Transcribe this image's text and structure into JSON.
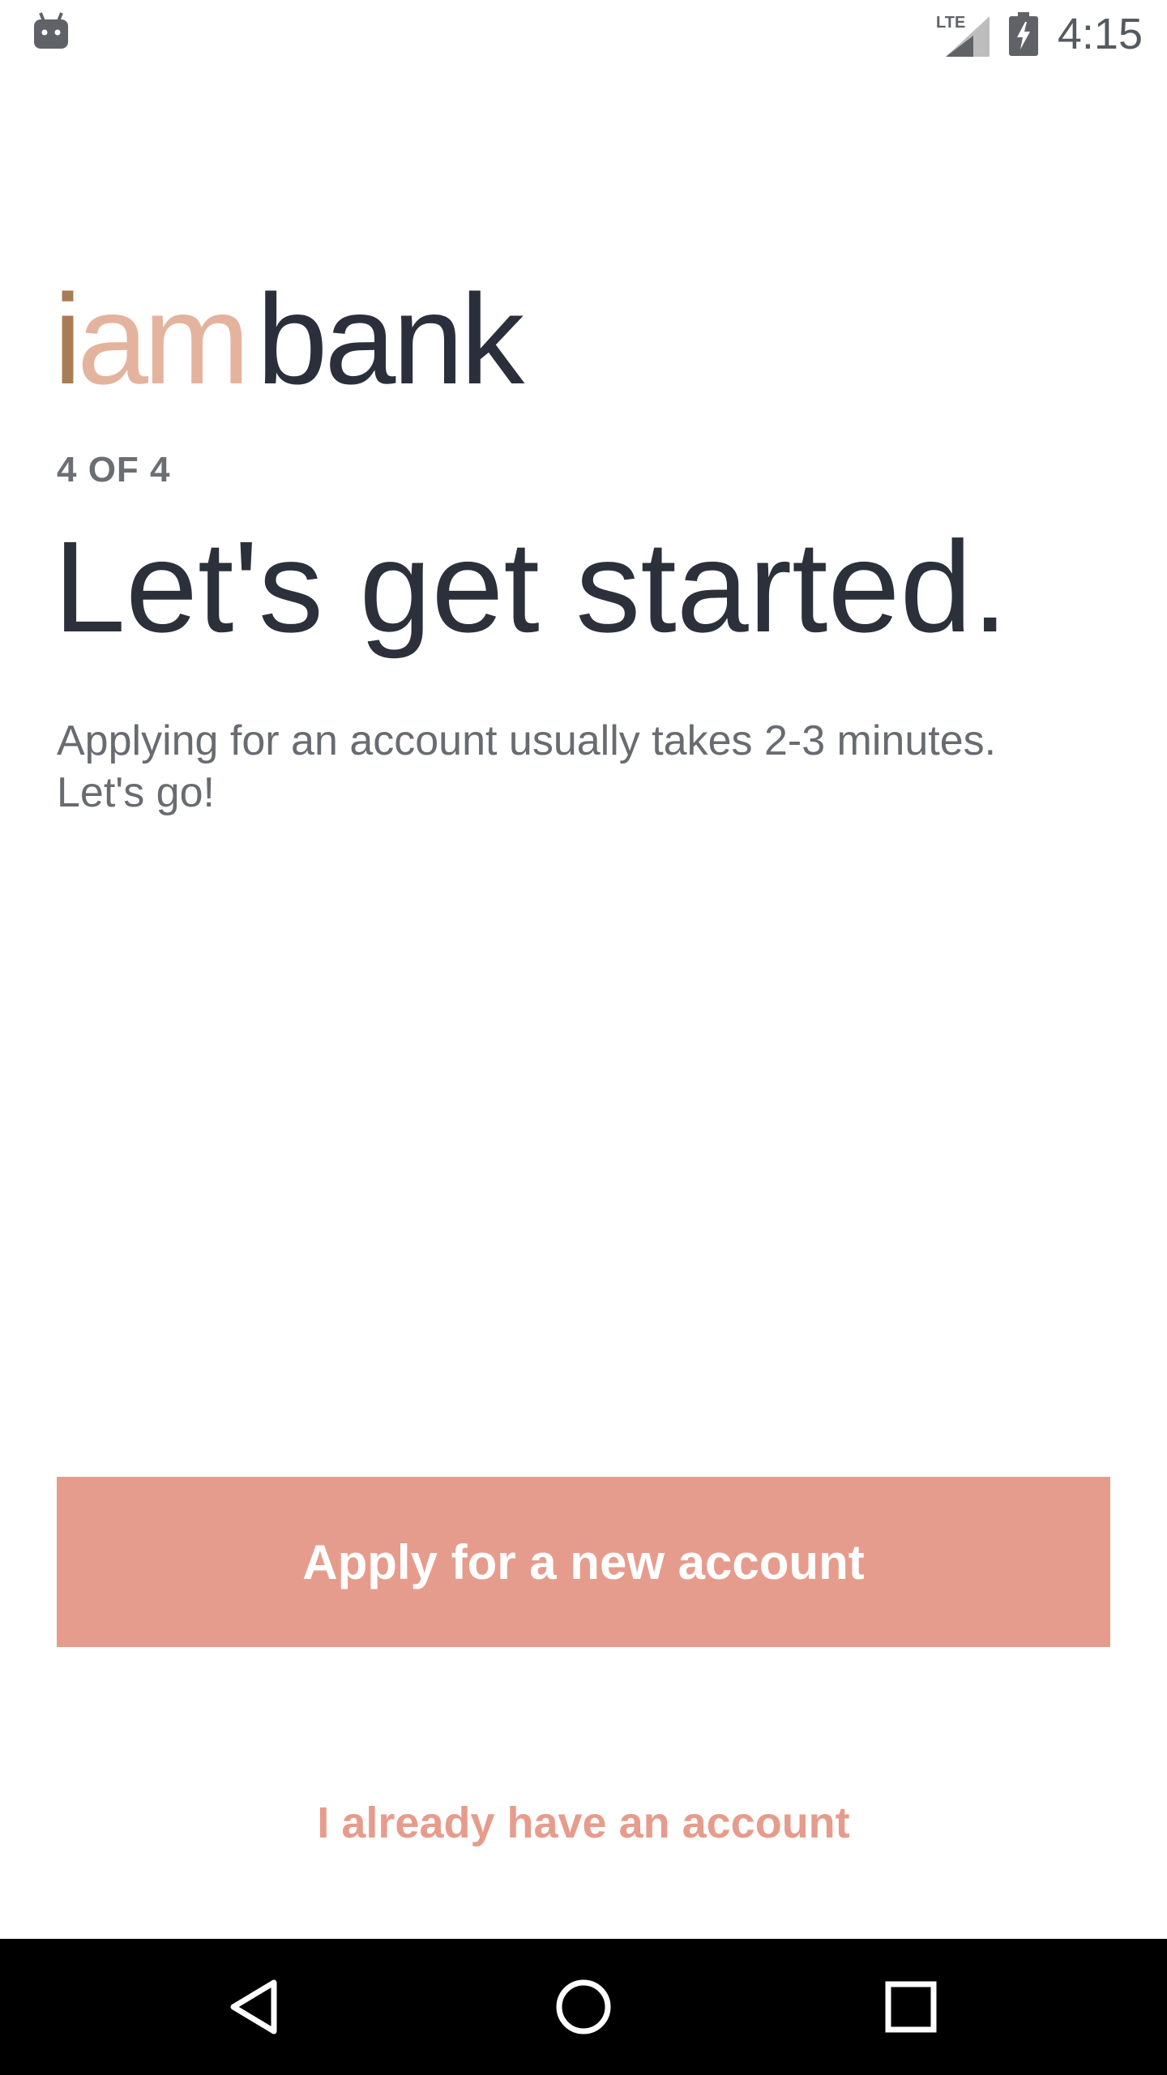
{
  "status_bar": {
    "time": "4:15",
    "network": "LTE",
    "left_icon": "android-robot-icon",
    "signal_icon": "signal-icon",
    "battery_icon": "battery-charging-icon"
  },
  "logo": {
    "part_i": "i",
    "part_am": "am",
    "part_bank": "bank",
    "colors": {
      "i": "#a87c55",
      "am": "#e4b39e",
      "bank": "#2a2f3b"
    }
  },
  "onboarding": {
    "step": "4 OF 4",
    "headline": "Let's get started.",
    "subtext_line1": "Applying for an account usually takes 2-3 minutes.",
    "subtext_line2": "Let's go!"
  },
  "actions": {
    "primary_label": "Apply for a new account",
    "secondary_label": "I already have an account",
    "accent_color": "#e69c8c"
  },
  "nav_bar": {
    "back_icon": "back-triangle-icon",
    "home_icon": "home-circle-icon",
    "recents_icon": "recents-square-icon"
  }
}
